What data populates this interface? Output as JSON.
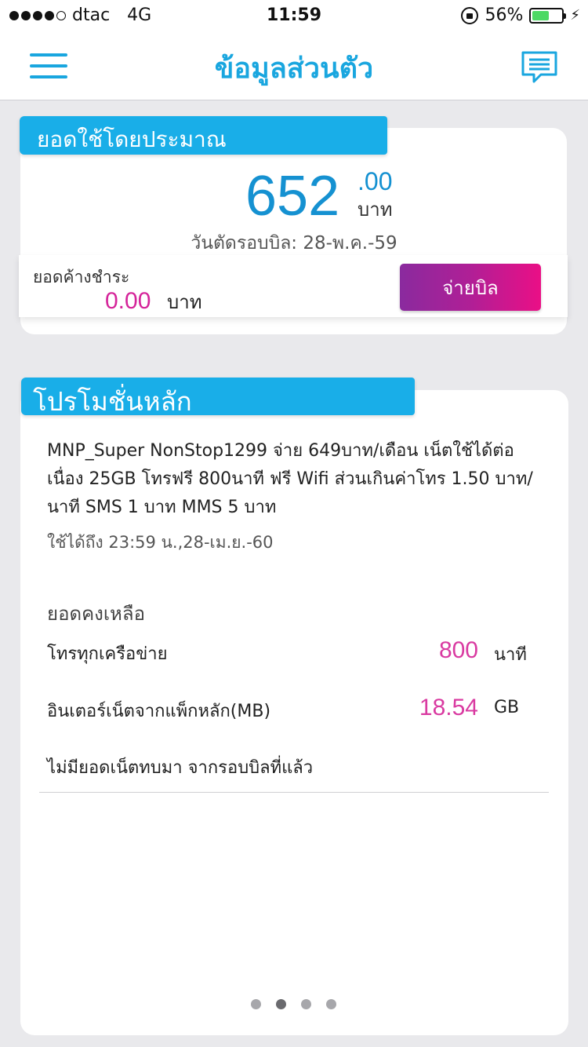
{
  "status_bar": {
    "carrier": "dtac",
    "network": "4G",
    "time": "11:59",
    "battery": "56%",
    "battery_level": 0.56,
    "icons": [
      "signal-dots",
      "rotation-lock-icon",
      "battery-icon",
      "charging-bolt-icon"
    ]
  },
  "header": {
    "title": "ข้อมูลส่วนตัว",
    "menu_icon": "hamburger-icon",
    "message_icon": "chat-icon"
  },
  "bill": {
    "tag": "ยอดใช้โดยประมาณ",
    "amount": "652",
    "cents": ".00",
    "unit": "บาท",
    "cutoff": "วันตัดรอบบิล: 28-พ.ค.-59",
    "outstanding_label": "ยอดค้างชำระ",
    "outstanding_value": "0.00",
    "outstanding_unit": "บาท",
    "pay_button": "จ่ายบิล"
  },
  "promotion": {
    "tag": "โปรโมชั่นหลัก",
    "description": "MNP_Super NonStop1299 จ่าย 649บาท/เดือน เน็ตใช้ได้ต่อเนื่อง 25GB โทรฟรี 800นาที ฟรี Wifi ส่วนเกินค่าโทร 1.50 บาท/นาที SMS 1 บาท MMS 5 บาท",
    "valid_until": "ใช้ได้ถึง 23:59 น.,28-เม.ย.-60",
    "balance_heading": "ยอดคงเหลือ",
    "balances": [
      {
        "label": "โทรทุกเครือข่าย",
        "value": "800",
        "unit": "นาที"
      },
      {
        "label": "อินเตอร์เน็ตจากแพ็กหลัก(MB)",
        "value": "18.54",
        "unit": "GB"
      }
    ],
    "carry_note": "ไม่มียอดเน็ตทบมา จากรอบบิลที่แล้ว"
  },
  "pager": {
    "count": 4,
    "active_index": 1
  },
  "colors": {
    "accent_blue": "#19a6df",
    "tag_blue": "#19aee8",
    "amount_blue": "#1591d1",
    "magenta": "#d93aa1",
    "pay_gradient_start": "#8a2a9e",
    "pay_gradient_end": "#ea0f86"
  }
}
